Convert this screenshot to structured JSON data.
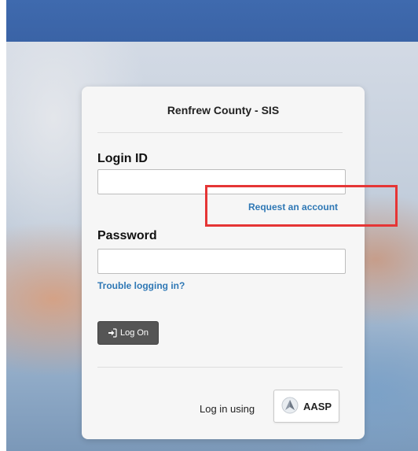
{
  "login": {
    "title": "Renfrew County - SIS",
    "login_id_label": "Login ID",
    "login_id_value": "",
    "request_account": "Request an account",
    "password_label": "Password",
    "password_value": "",
    "trouble": "Trouble logging in?",
    "logon_button": "Log On",
    "login_using": "Log in using",
    "aasp_button": "AASP"
  },
  "colors": {
    "topbar": "#3d67aa",
    "link": "#2f78b5",
    "annotation": "#e53535"
  },
  "icons": [
    "sign-in-icon",
    "aasp-logo-icon"
  ]
}
